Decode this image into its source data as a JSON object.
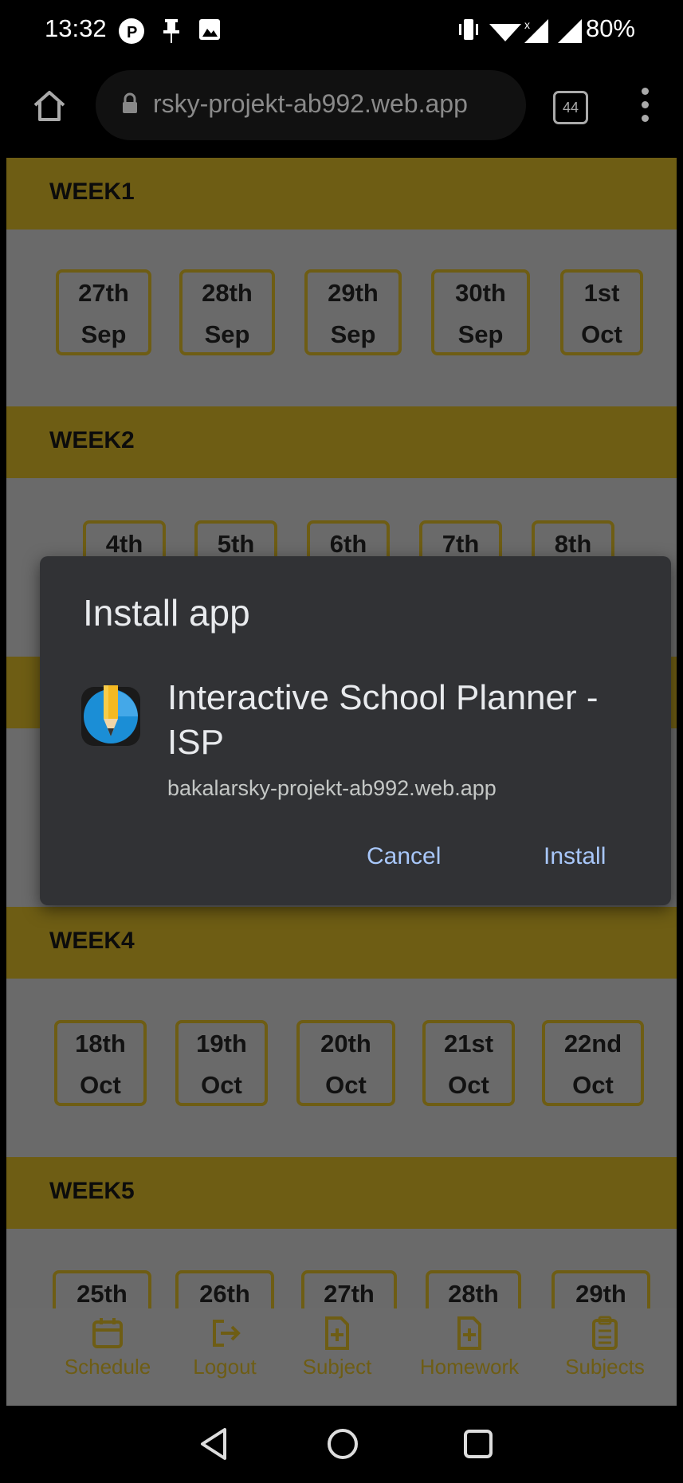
{
  "status_bar": {
    "time": "13:32",
    "battery": "80%"
  },
  "browser": {
    "url": "rsky-projekt-ab992.web.app",
    "tab_count": "44"
  },
  "weeks": [
    {
      "label": "WEEK1",
      "days": [
        [
          "27th",
          "Sep"
        ],
        [
          "28th",
          "Sep"
        ],
        [
          "29th",
          "Sep"
        ],
        [
          "30th",
          "Sep"
        ],
        [
          "1st",
          "Oct"
        ]
      ]
    },
    {
      "label": "WEEK2",
      "days": [
        [
          "4th",
          ""
        ],
        [
          "5th",
          ""
        ],
        [
          "6th",
          ""
        ],
        [
          "7th",
          ""
        ],
        [
          "8th",
          ""
        ]
      ]
    },
    {
      "label": "WEEK4",
      "days": [
        [
          "18th",
          "Oct"
        ],
        [
          "19th",
          "Oct"
        ],
        [
          "20th",
          "Oct"
        ],
        [
          "21st",
          "Oct"
        ],
        [
          "22nd",
          "Oct"
        ]
      ]
    },
    {
      "label": "WEEK5",
      "days": [
        [
          "25th",
          ""
        ],
        [
          "26th",
          ""
        ],
        [
          "27th",
          ""
        ],
        [
          "28th",
          ""
        ],
        [
          "29th",
          ""
        ]
      ]
    }
  ],
  "bottom_nav": [
    "Schedule",
    "Logout",
    "Subject",
    "Homework",
    "Subjects"
  ],
  "dialog": {
    "title": "Install app",
    "app_name": "Interactive School Planner - ISP",
    "app_url": "bakalarsky-projekt-ab992.web.app",
    "cancel": "Cancel",
    "install": "Install"
  },
  "colors": {
    "accent": "#DDBB2A",
    "dialog_bg": "#313235",
    "dialog_button": "#A8C7FA"
  }
}
